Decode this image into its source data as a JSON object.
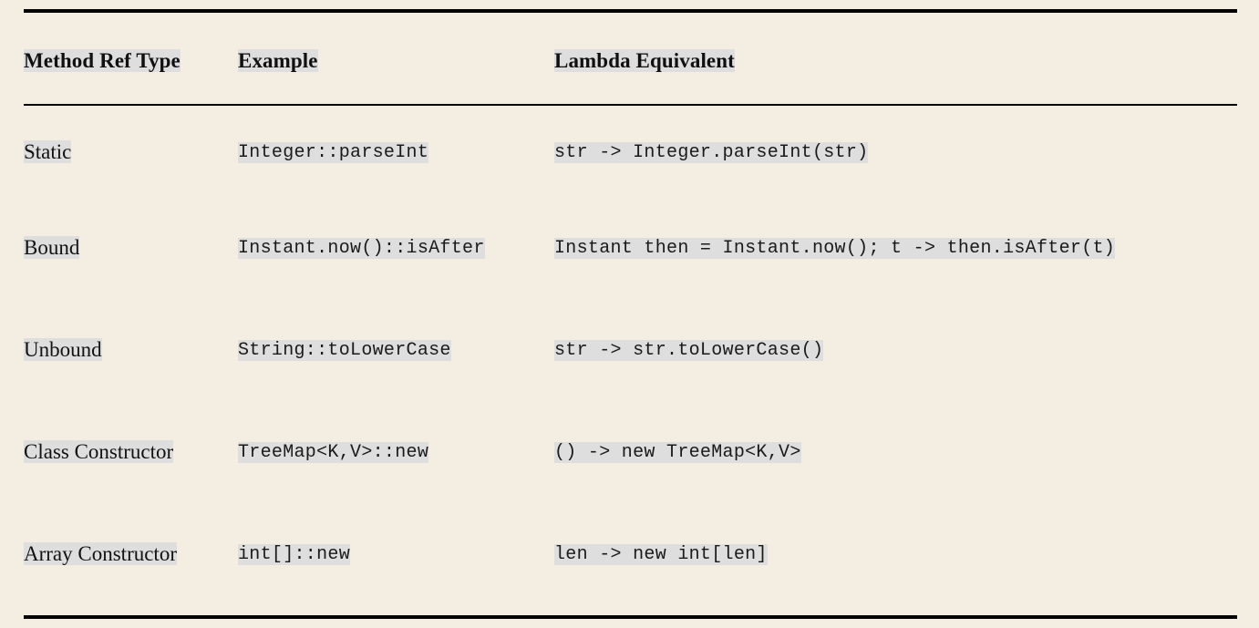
{
  "table": {
    "columns": [
      {
        "key": "type",
        "label": "Method Ref Type"
      },
      {
        "key": "example",
        "label": "Example"
      },
      {
        "key": "lambda",
        "label": "Lambda Equivalent"
      }
    ],
    "rows": [
      {
        "type": "Static",
        "example": "Integer::parseInt",
        "lambda": "str -> Integer.parseInt(str)"
      },
      {
        "type": "Bound",
        "example": "Instant.now()::isAfter",
        "lambda": "Instant then = Instant.now(); t -> then.isAfter(t)"
      },
      {
        "type": "Unbound",
        "example": "String::toLowerCase",
        "lambda": "str -> str.toLowerCase()"
      },
      {
        "type": "Class Constructor",
        "example": "TreeMap<K,V>::new",
        "lambda": "() -> new TreeMap<K,V>"
      },
      {
        "type": "Array Constructor",
        "example": "int[]::new",
        "lambda": "len -> new int[len]"
      }
    ]
  },
  "colors": {
    "page_background": "#f4ede2",
    "highlight": "#dedede",
    "rule": "#000000",
    "text": "#121212"
  }
}
